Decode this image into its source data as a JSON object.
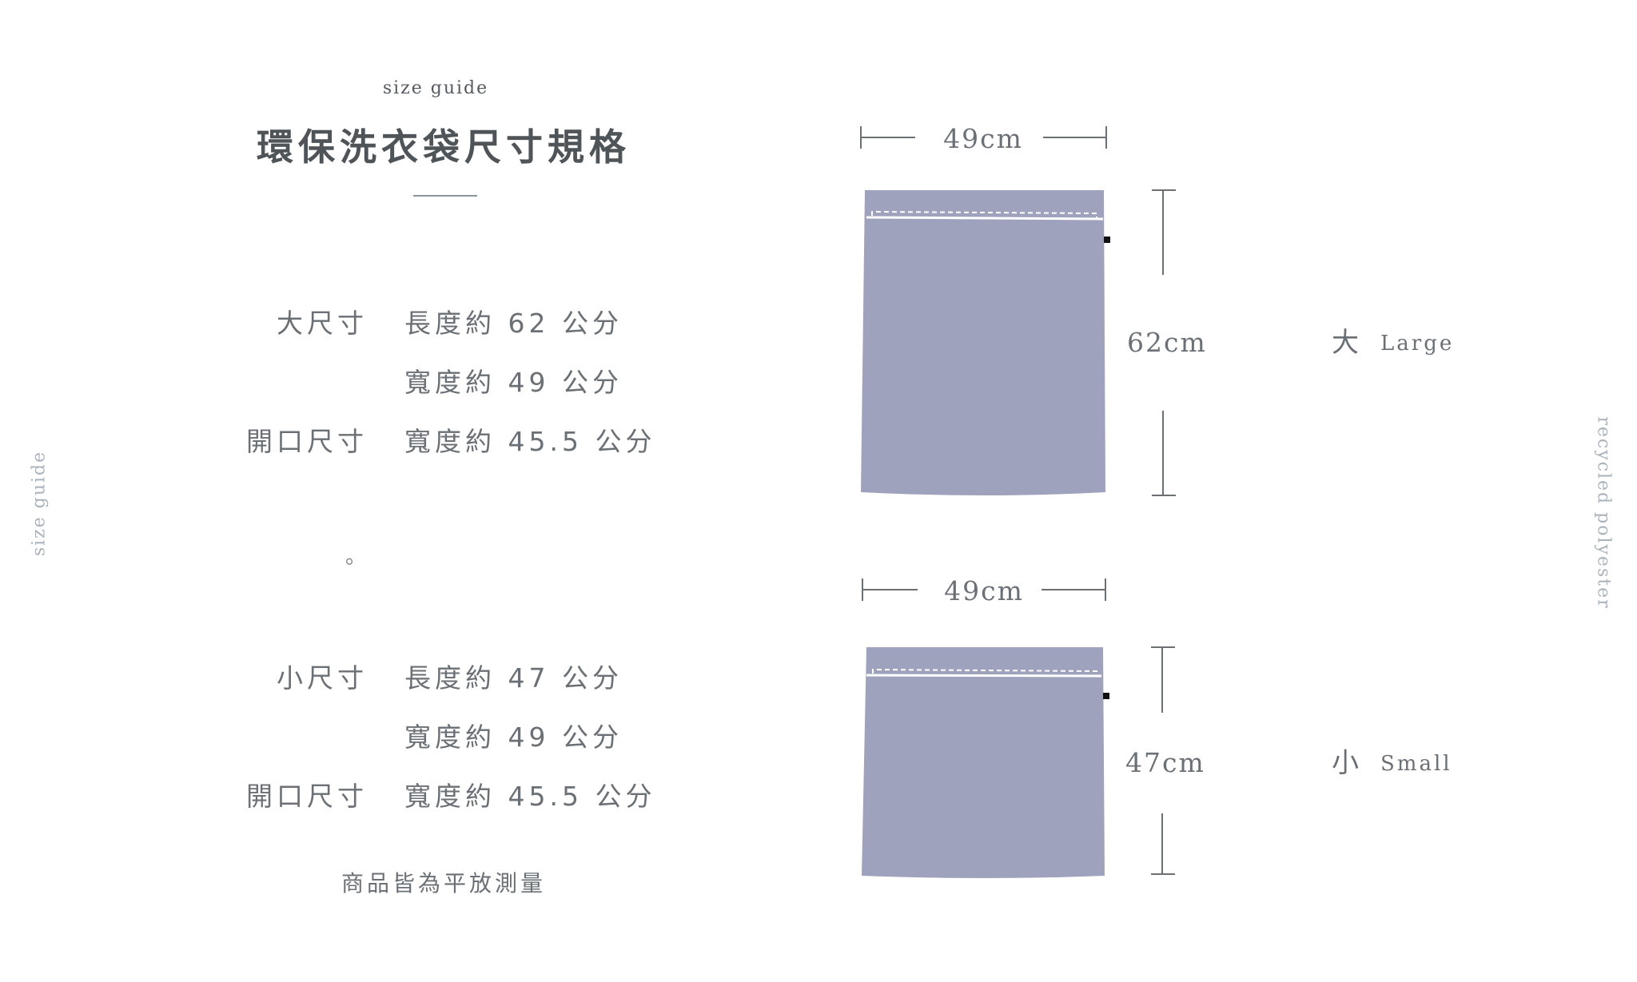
{
  "header": {
    "subtitle": "size guide",
    "title": "環保洗衣袋尺寸規格"
  },
  "side_labels": {
    "left": "size guide",
    "right": "recycled polyester"
  },
  "large": {
    "label": "大尺寸",
    "length": "長度約 62 公分",
    "width": "寬度約 49 公分",
    "opening_label": "開口尺寸",
    "opening": "寬度約 45.5 公分"
  },
  "separator": "。",
  "small": {
    "label": "小尺寸",
    "length": "長度約 47 公分",
    "width": "寬度約 49 公分",
    "opening_label": "開口尺寸",
    "opening": "寬度約 45.5 公分"
  },
  "note": "商品皆為平放測量",
  "diagram": {
    "bag_color": "#9ea2bd",
    "line_color": "#6b7075",
    "large": {
      "width_label": "49cm",
      "height_label": "62cm",
      "size_cn": "大",
      "size_en": "Large"
    },
    "small": {
      "width_label": "49cm",
      "height_label": "47cm",
      "size_cn": "小",
      "size_en": "Small"
    }
  }
}
